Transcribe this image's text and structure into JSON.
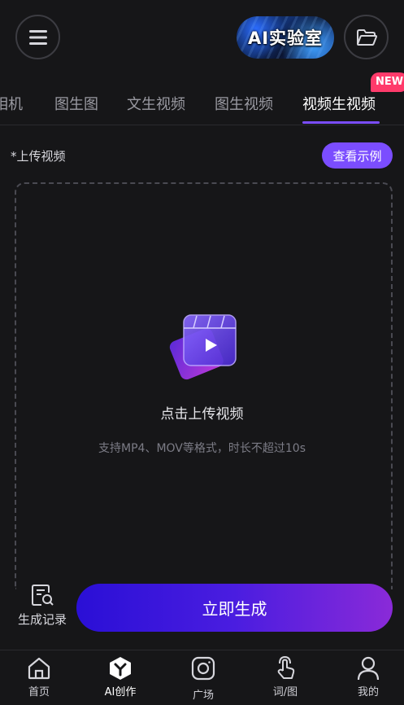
{
  "header": {
    "lab_banner_text": "AI实验室"
  },
  "tabs": {
    "items": [
      {
        "label": "相机"
      },
      {
        "label": "图生图"
      },
      {
        "label": "文生视频"
      },
      {
        "label": "图生视频"
      },
      {
        "label": "视频生视频"
      }
    ],
    "active_index": 4,
    "new_badge": "NEW"
  },
  "upload": {
    "label": "*上传视频",
    "example_button": "查看示例",
    "title": "点击上传视频",
    "hint": "支持MP4、MOV等格式，时长不超过10s"
  },
  "actions": {
    "history_label": "生成记录",
    "generate_label": "立即生成"
  },
  "bottom_nav": {
    "items": [
      {
        "label": "首页",
        "icon": "home-icon"
      },
      {
        "label": "AI创作",
        "icon": "ai-create-icon"
      },
      {
        "label": "广场",
        "icon": "plaza-icon"
      },
      {
        "label": "词/图",
        "icon": "touch-icon"
      },
      {
        "label": "我的",
        "icon": "profile-icon"
      }
    ],
    "active_index": 1
  },
  "colors": {
    "accent": "#7b4dff",
    "badge": "#ff3b6b",
    "background": "#161618"
  }
}
